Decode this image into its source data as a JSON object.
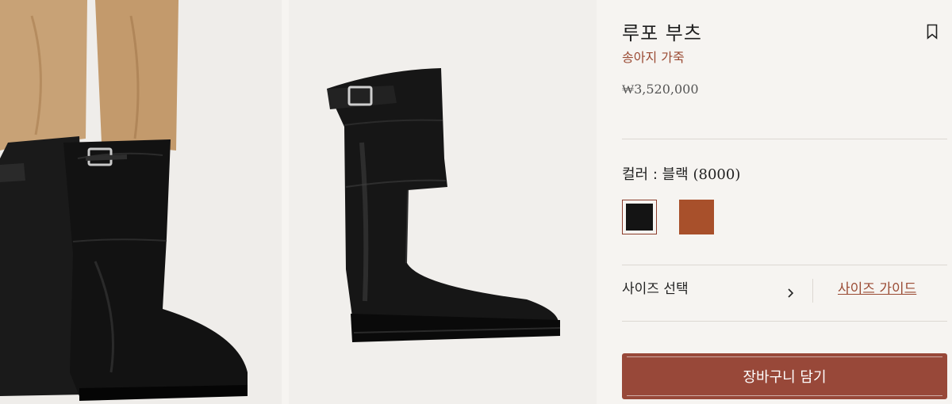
{
  "product": {
    "title": "루포 부츠",
    "material": "송아지 가죽",
    "price": "₩3,520,000"
  },
  "color": {
    "label": "컬러 : 블랙",
    "code": "(8000)",
    "options": [
      {
        "name": "블랙",
        "hex": "#141414",
        "selected": true
      },
      {
        "name": "브라운",
        "hex": "#a8502b",
        "selected": false
      }
    ]
  },
  "size": {
    "select_label": "사이즈 선택",
    "guide_label": "사이즈 가이드"
  },
  "cart": {
    "button_label": "장바구니 담기"
  },
  "theme": {
    "accent": "#984839",
    "background": "#f6f4f1"
  }
}
